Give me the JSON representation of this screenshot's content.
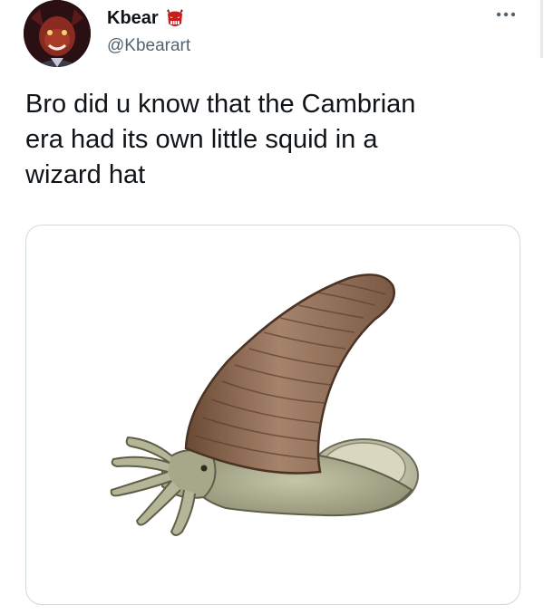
{
  "tweet": {
    "display_name": "Kbear",
    "handle": "@Kbearart",
    "text": "Bro did u know that the Cambrian\nera had its own little squid in a\nwizard hat",
    "more_icon": "more-horizontal-icon",
    "badge_icon": "demon-mask-emoji-icon"
  },
  "colors": {
    "text_primary": "#0f1419",
    "text_secondary": "#536471",
    "card_border": "#cfd9de",
    "shell": "#9c7d66",
    "body": "#b7b89a"
  }
}
